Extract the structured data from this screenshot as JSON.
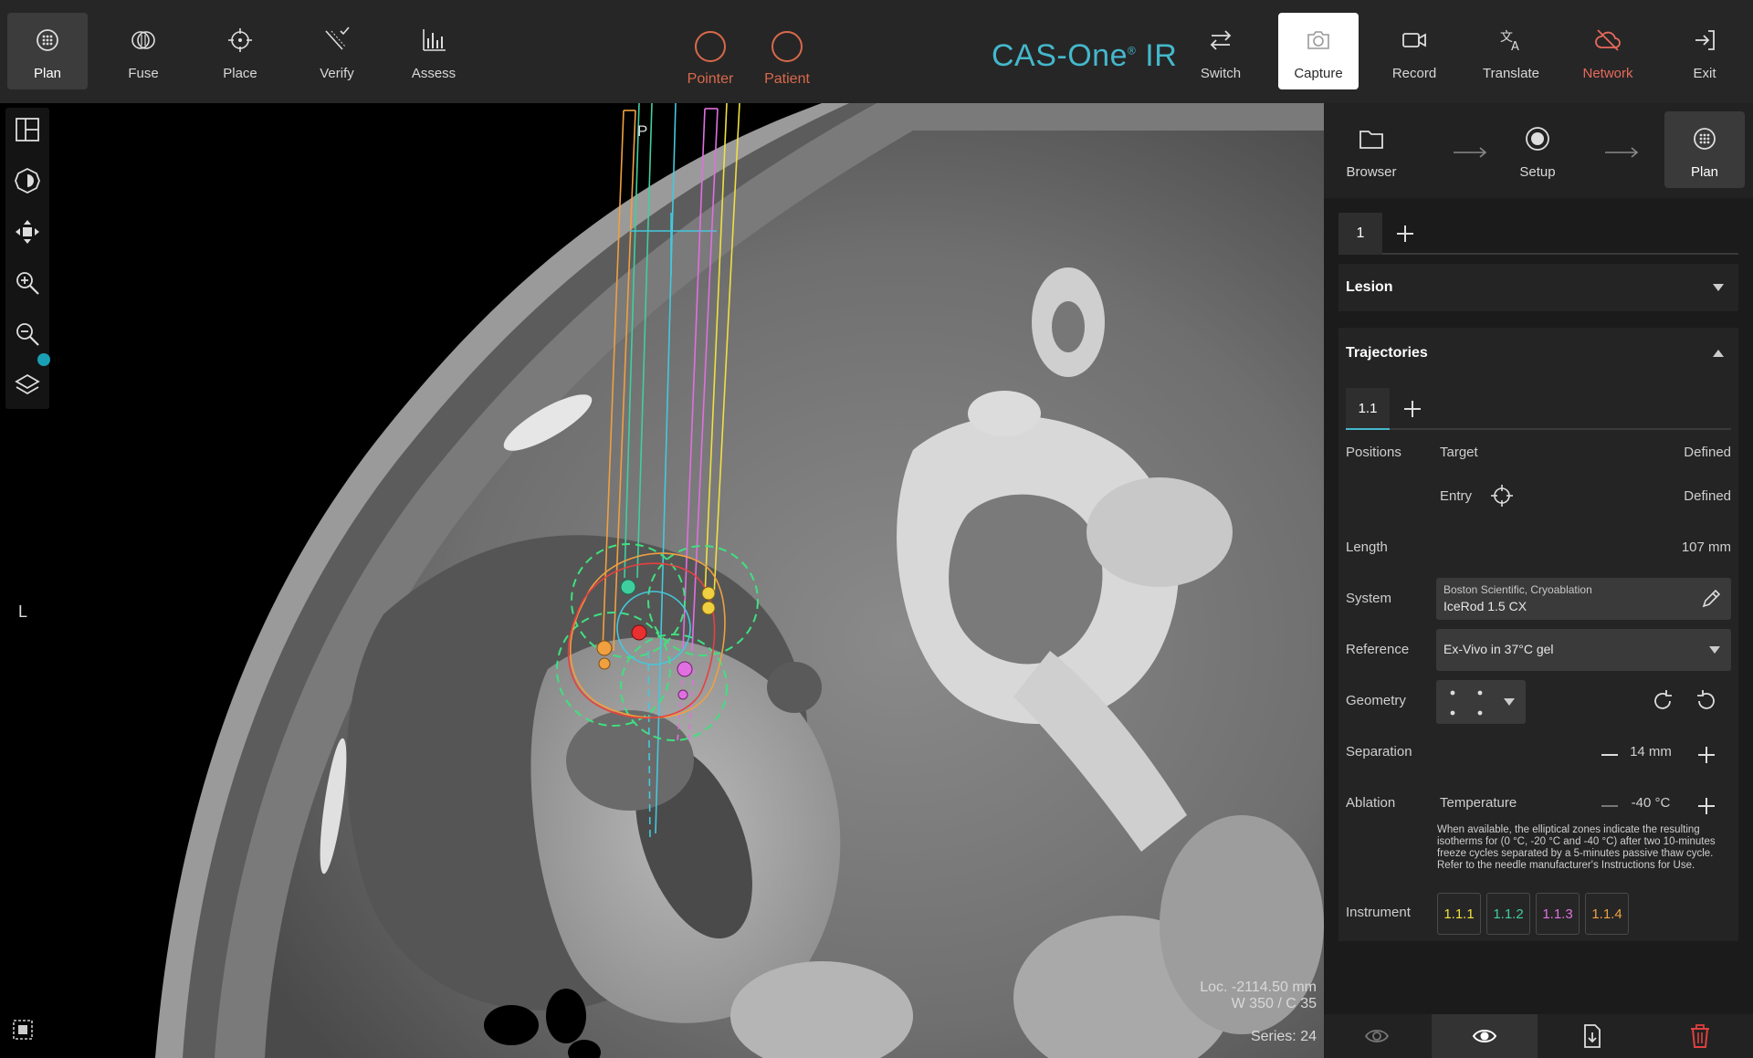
{
  "topbar": {
    "left_tools": [
      {
        "label": "Plan",
        "icon": "plan-icon",
        "active": true
      },
      {
        "label": "Fuse",
        "icon": "fuse-icon"
      },
      {
        "label": "Place",
        "icon": "place-icon"
      },
      {
        "label": "Verify",
        "icon": "verify-icon"
      },
      {
        "label": "Assess",
        "icon": "assess-icon"
      }
    ],
    "pointer_label": "Pointer",
    "patient_label": "Patient",
    "brand": "CAS-One",
    "brand_mark": "®",
    "brand_suffix": " IR",
    "right_tools": [
      {
        "label": "Switch",
        "icon": "switch-icon"
      },
      {
        "label": "Capture",
        "icon": "camera-icon",
        "highlight": true
      },
      {
        "label": "Record",
        "icon": "video-icon"
      },
      {
        "label": "Translate",
        "icon": "translate-icon"
      },
      {
        "label": "Network",
        "icon": "network-off-icon",
        "color": "#e86a5c"
      },
      {
        "label": "Exit",
        "icon": "exit-icon"
      }
    ],
    "accent_color": "#44b8cc",
    "alert_color": "#d9694b"
  },
  "viewport": {
    "orientation_left": "L",
    "orientation_top": "P",
    "loc": "Loc. -2114.50 mm",
    "window": "W 350 / C 35",
    "series": "Series: 24"
  },
  "workflow": {
    "steps": [
      {
        "label": "Browser",
        "icon": "folder-icon"
      },
      {
        "label": "Setup",
        "icon": "target-icon"
      },
      {
        "label": "Plan",
        "icon": "plan-icon",
        "active": true
      }
    ]
  },
  "plan_tabs": [
    "1"
  ],
  "lesion": {
    "title": "Lesion"
  },
  "trajectories": {
    "title": "Trajectories",
    "tabs": [
      "1.1"
    ],
    "positions_label": "Positions",
    "target_label": "Target",
    "target_value": "Defined",
    "entry_label": "Entry",
    "entry_value": "Defined",
    "length_label": "Length",
    "length_value": "107 mm",
    "system_label": "System",
    "system_vendor": "Boston Scientific, Cryoablation",
    "system_model": "IceRod 1.5 CX",
    "reference_label": "Reference",
    "reference_value": "Ex-Vivo in 37°C gel",
    "geometry_label": "Geometry",
    "separation_label": "Separation",
    "separation_value": "14 mm",
    "ablation_label": "Ablation",
    "temperature_label": "Temperature",
    "temperature_value": "-40 °C",
    "note": "When available, the elliptical zones indicate the resulting isotherms for (0 °C, -20 °C and -40 °C) after two 10-minutes freeze cycles separated by a 5-minutes passive thaw cycle. Refer to the needle manufacturer's Instructions for Use.",
    "instrument_label": "Instrument",
    "instruments": [
      {
        "label": "1.1.1",
        "color": "#f0e040"
      },
      {
        "label": "1.1.2",
        "color": "#3fcf9f"
      },
      {
        "label": "1.1.3",
        "color": "#e070e0"
      },
      {
        "label": "1.1.4",
        "color": "#f0a040"
      }
    ]
  }
}
